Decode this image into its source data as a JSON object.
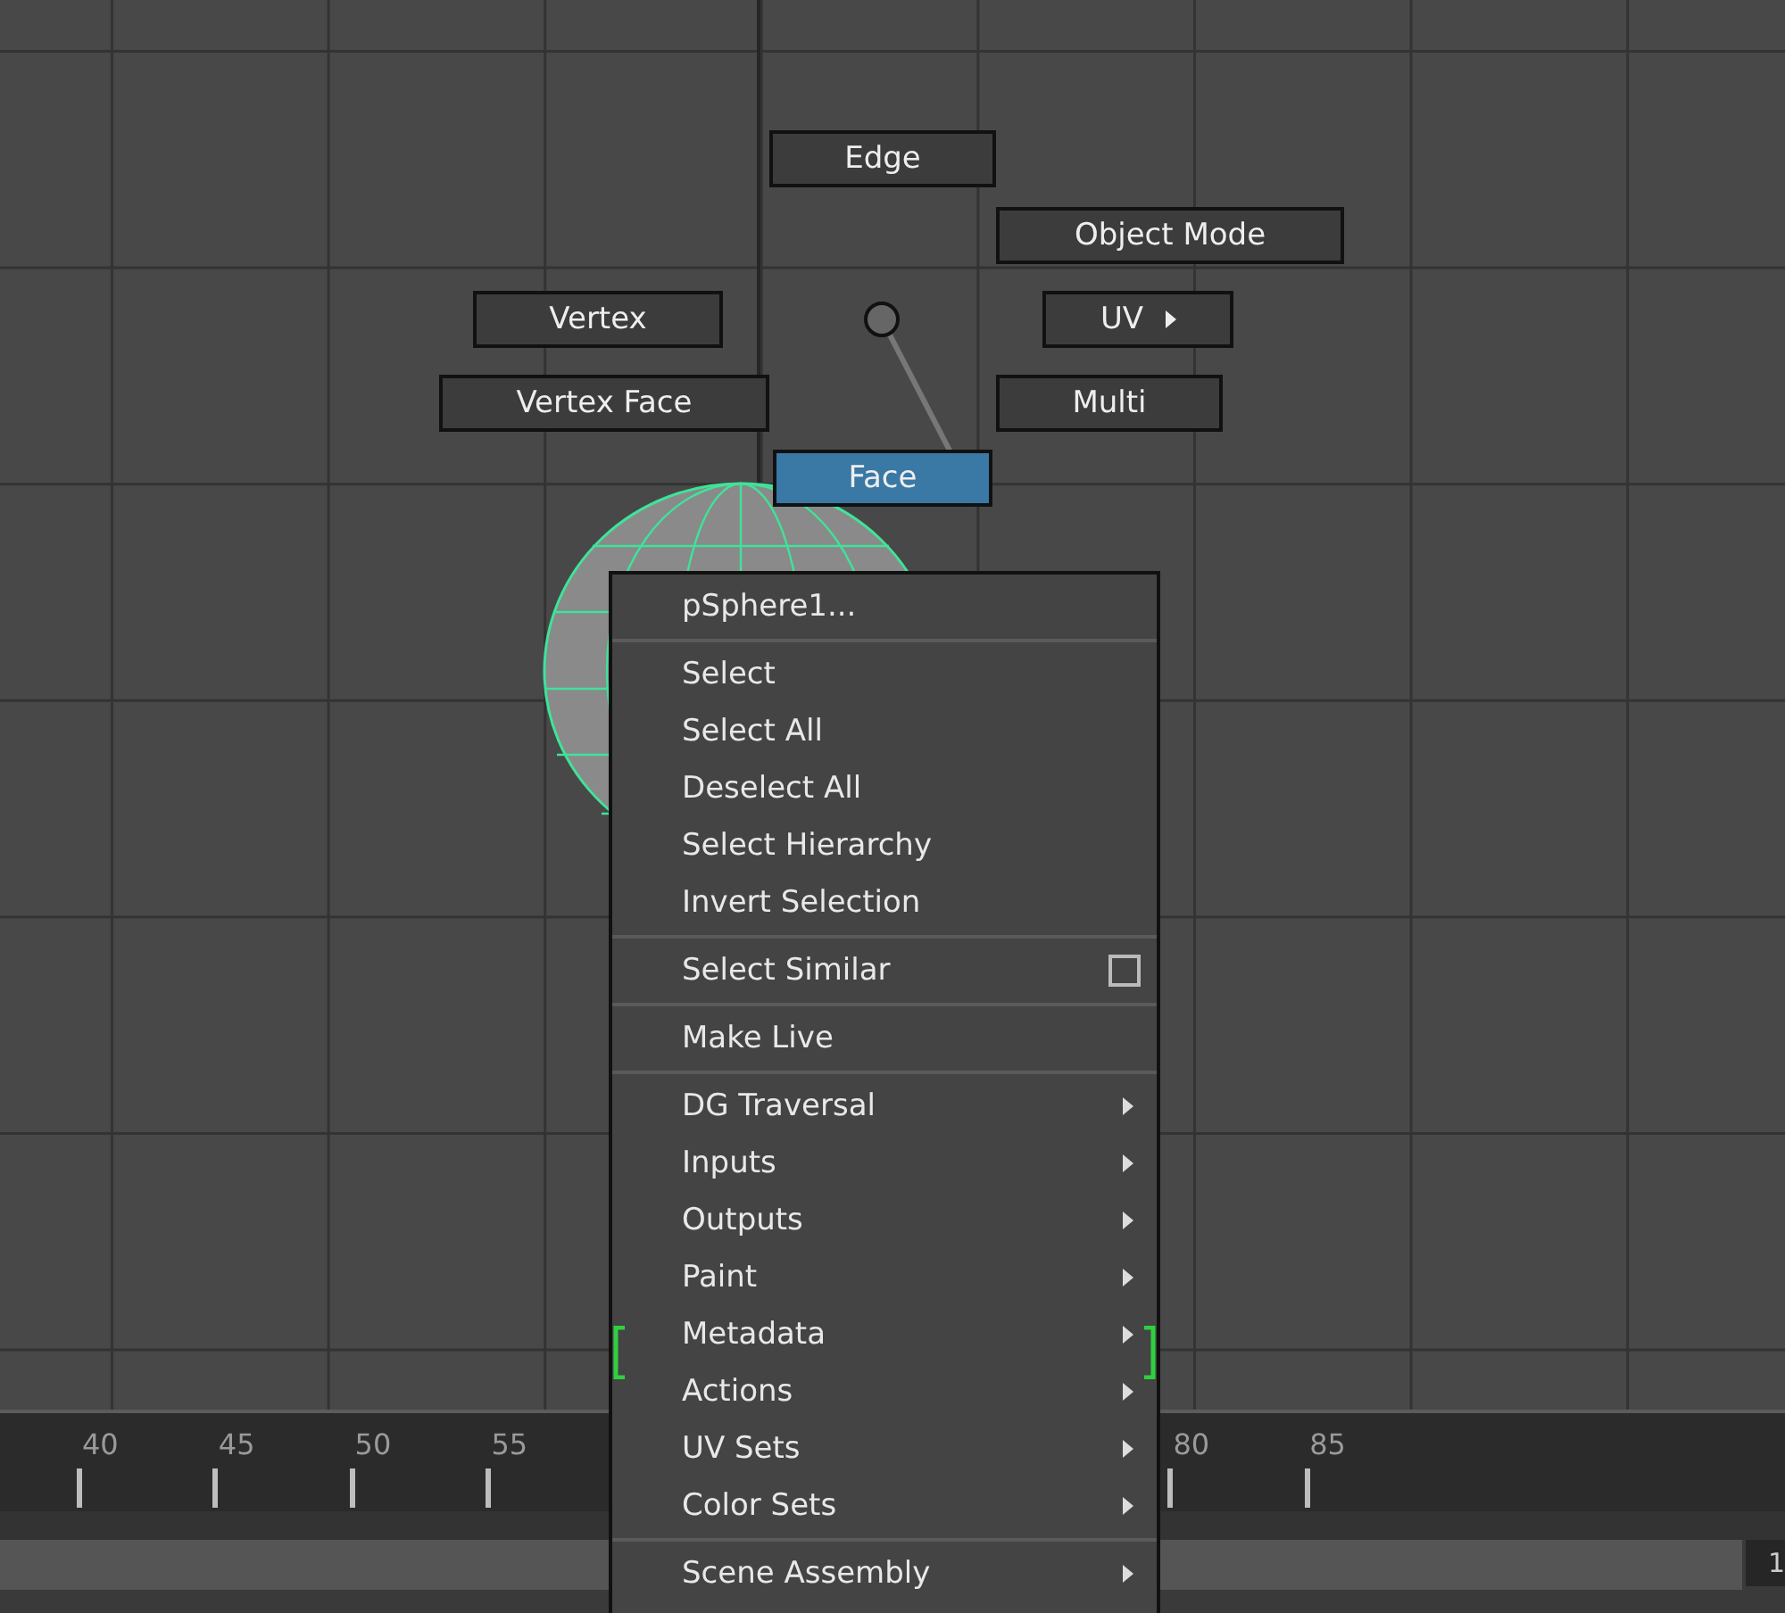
{
  "marking_menu": [
    {
      "label": "Edge",
      "selected": false,
      "submenu": false
    },
    {
      "label": "Object Mode",
      "selected": false,
      "submenu": false
    },
    {
      "label": "Vertex",
      "selected": false,
      "submenu": false
    },
    {
      "label": "UV",
      "selected": false,
      "submenu": true
    },
    {
      "label": "Vertex Face",
      "selected": false,
      "submenu": false
    },
    {
      "label": "Multi",
      "selected": false,
      "submenu": false
    },
    {
      "label": "Face",
      "selected": true,
      "submenu": false
    }
  ],
  "context_menu": [
    {
      "kind": "header",
      "label": "pSphere1..."
    },
    {
      "kind": "separator"
    },
    {
      "kind": "item",
      "label": "Select"
    },
    {
      "kind": "item",
      "label": "Select All"
    },
    {
      "kind": "item",
      "label": "Deselect All"
    },
    {
      "kind": "item",
      "label": "Select Hierarchy"
    },
    {
      "kind": "item",
      "label": "Invert Selection"
    },
    {
      "kind": "separator"
    },
    {
      "kind": "option",
      "label": "Select Similar"
    },
    {
      "kind": "separator"
    },
    {
      "kind": "item",
      "label": "Make Live"
    },
    {
      "kind": "separator"
    },
    {
      "kind": "submenu",
      "label": "DG Traversal"
    },
    {
      "kind": "submenu",
      "label": "Inputs"
    },
    {
      "kind": "submenu",
      "label": "Outputs"
    },
    {
      "kind": "submenu",
      "label": "Paint"
    },
    {
      "kind": "submenu",
      "label": "Metadata"
    },
    {
      "kind": "submenu",
      "label": "Actions"
    },
    {
      "kind": "submenu",
      "label": "UV Sets"
    },
    {
      "kind": "submenu",
      "label": "Color Sets"
    },
    {
      "kind": "separator"
    },
    {
      "kind": "submenu",
      "label": "Scene Assembly"
    }
  ],
  "timeline": {
    "labels": [
      "40",
      "45",
      "50",
      "55",
      "80",
      "85"
    ]
  },
  "range_field": "1"
}
